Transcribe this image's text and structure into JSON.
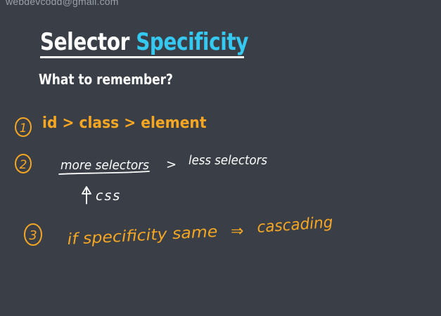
{
  "watermark": "webdevcodd@gmail.com",
  "title": {
    "part1": "Selector",
    "part2": "Specificity"
  },
  "subtitle": "What to remember?",
  "rules": [
    {
      "number": "1",
      "text": "id > class > element"
    },
    {
      "number": "2",
      "text": "more selectors",
      "compare": ">",
      "text2": "less selectors",
      "note": "css"
    },
    {
      "number": "3",
      "text": "if specificity same",
      "arrow": "⇒",
      "text2": "cascading"
    }
  ],
  "colors": {
    "background": "#3a3f47",
    "title_accent": "#35c8f0",
    "ink_orange": "#f5a623",
    "ink_white": "#ffffff"
  }
}
